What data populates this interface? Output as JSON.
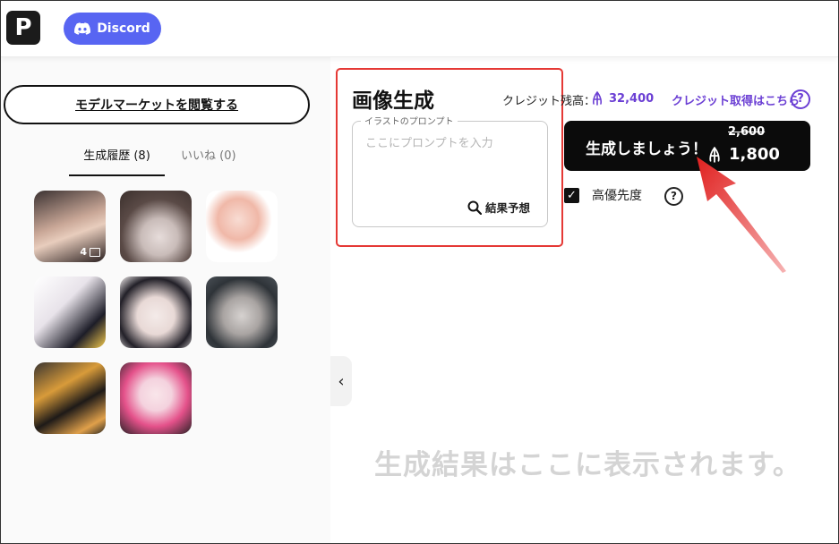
{
  "header": {
    "logo_letter": "P",
    "discord_label": "Discord",
    "icons": {
      "discord": "discord-icon"
    },
    "colors": {
      "discord": "#5865f2",
      "logo_bg": "#1b1b1b"
    }
  },
  "sidebar": {
    "market_button": "モデルマーケットを閲覧する",
    "tabs": [
      {
        "label": "生成履歴 (8)",
        "active": true
      },
      {
        "label": "いいね (0)",
        "active": false
      }
    ],
    "history_thumbnails": [
      {
        "name": "history-thumb-1",
        "badge_count": "4",
        "colors": [
          "#d8b9a8",
          "#2a2020"
        ]
      },
      {
        "name": "history-thumb-2",
        "colors": [
          "#5a4a46",
          "#d4c7c6"
        ]
      },
      {
        "name": "history-thumb-3",
        "colors": [
          "#f3c9bf",
          "#e9783c"
        ]
      },
      {
        "name": "history-thumb-4",
        "colors": [
          "#e8e3ea",
          "#1d1d28"
        ]
      },
      {
        "name": "history-thumb-5",
        "colors": [
          "#efe8ea",
          "#222028"
        ]
      },
      {
        "name": "history-thumb-6",
        "colors": [
          "#3a3f44",
          "#c8c4c2"
        ]
      },
      {
        "name": "history-thumb-7",
        "colors": [
          "#2f2a24",
          "#d89b3a"
        ]
      },
      {
        "name": "history-thumb-8",
        "colors": [
          "#f4d2de",
          "#e4518a"
        ]
      }
    ]
  },
  "main": {
    "title": "画像生成",
    "prompt": {
      "legend": "イラストのプロンプト",
      "placeholder": "ここにプロンプトを入力",
      "value": ""
    },
    "predict_button": "結果予想",
    "credits": {
      "label": "クレジット残高：",
      "value": "32,400",
      "get_link": "クレジット取得はこちら",
      "accent_color": "#6b3fd4"
    },
    "generate_button": {
      "label": "生成しましょう！",
      "original_cost": "2,600",
      "cost": "1,800"
    },
    "priority": {
      "label": "高優先度",
      "checked": true
    },
    "empty_message": "生成結果はここに表示されます。"
  },
  "annotations": {
    "highlight_color": "#e53935"
  }
}
